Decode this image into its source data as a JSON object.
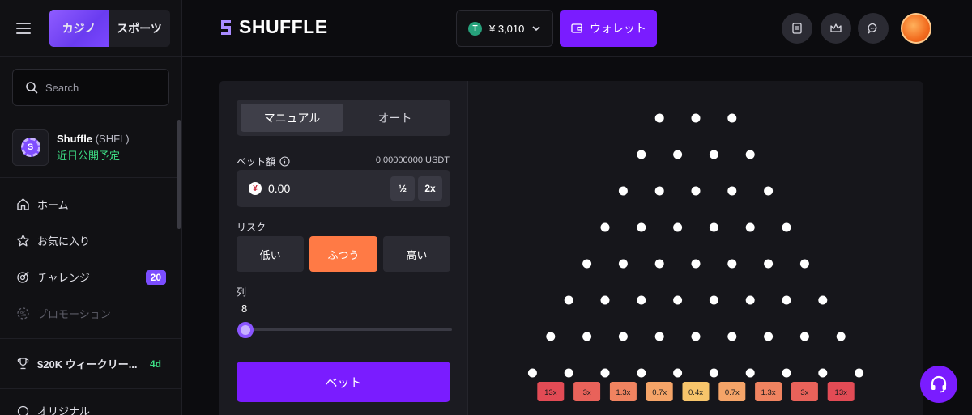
{
  "sidebar": {
    "mode_tabs": [
      {
        "label": "カジノ"
      },
      {
        "label": "スポーツ"
      }
    ],
    "search": {
      "placeholder": "Search"
    },
    "shfl": {
      "name": "Shuffle",
      "ticker": "(SHFL)",
      "status": "近日公開予定"
    },
    "nav": [
      {
        "label": "ホーム",
        "icon": "home-icon"
      },
      {
        "label": "お気に入り",
        "icon": "star-icon"
      },
      {
        "label": "チャレンジ",
        "icon": "target-icon",
        "badge": "20"
      },
      {
        "label": "プロモーション",
        "icon": "promo-icon"
      },
      {
        "label": "$20K ウィークリー...",
        "icon": "trophy-icon",
        "tag": "4d"
      },
      {
        "label": "オリジナル",
        "icon": "original-icon"
      }
    ]
  },
  "header": {
    "logo": "SHUFFLE",
    "balance": "¥ 3,010",
    "currency_icon": "T",
    "wallet_label": "ウォレット",
    "icons": [
      "receipt-icon",
      "crown-icon",
      "chat-icon"
    ]
  },
  "game": {
    "mode_tabs": [
      {
        "label": "マニュアル"
      },
      {
        "label": "オート"
      }
    ],
    "bet_label": "ベット額",
    "bet_usdt": "0.00000000 USDT",
    "bet_currency": "¥",
    "bet_value": "0.00",
    "half_label": "½",
    "double_label": "2x",
    "risk_label": "リスク",
    "risk_options": [
      {
        "label": "低い"
      },
      {
        "label": "ふつう"
      },
      {
        "label": "高い"
      }
    ],
    "rows_label": "列",
    "rows_value": "8",
    "bet_button": "ベット",
    "multipliers": [
      {
        "label": "13x",
        "color": "#e24b55"
      },
      {
        "label": "3x",
        "color": "#e9625a"
      },
      {
        "label": "1.3x",
        "color": "#f08360"
      },
      {
        "label": "0.7x",
        "color": "#f5a468"
      },
      {
        "label": "0.4x",
        "color": "#f7c56b"
      },
      {
        "label": "0.7x",
        "color": "#f5a468"
      },
      {
        "label": "1.3x",
        "color": "#f08360"
      },
      {
        "label": "3x",
        "color": "#e9625a"
      },
      {
        "label": "13x",
        "color": "#e24b55"
      }
    ]
  },
  "colors": {
    "accent": "#7a1cff",
    "risk_active": "#ff7a45",
    "green": "#3ddc84"
  }
}
